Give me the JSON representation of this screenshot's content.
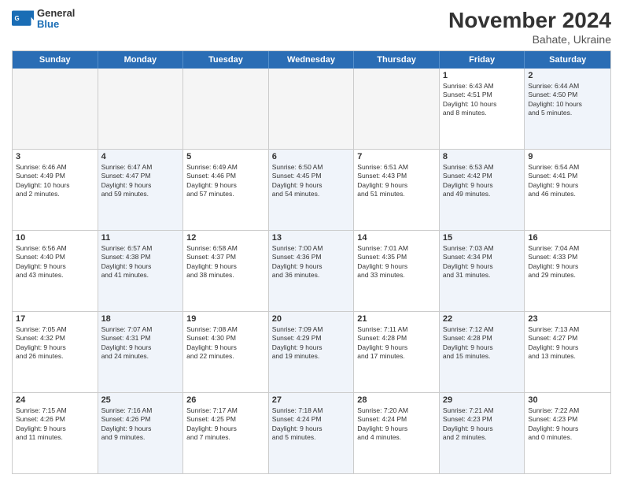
{
  "header": {
    "logo_general": "General",
    "logo_blue": "Blue",
    "month_title": "November 2024",
    "location": "Bahate, Ukraine"
  },
  "days_of_week": [
    "Sunday",
    "Monday",
    "Tuesday",
    "Wednesday",
    "Thursday",
    "Friday",
    "Saturday"
  ],
  "weeks": [
    [
      {
        "day": "",
        "info": "",
        "empty": true
      },
      {
        "day": "",
        "info": "",
        "empty": true
      },
      {
        "day": "",
        "info": "",
        "empty": true
      },
      {
        "day": "",
        "info": "",
        "empty": true
      },
      {
        "day": "",
        "info": "",
        "empty": true
      },
      {
        "day": "1",
        "info": "Sunrise: 6:43 AM\nSunset: 4:51 PM\nDaylight: 10 hours\nand 8 minutes.",
        "empty": false
      },
      {
        "day": "2",
        "info": "Sunrise: 6:44 AM\nSunset: 4:50 PM\nDaylight: 10 hours\nand 5 minutes.",
        "empty": false,
        "alt": true
      }
    ],
    [
      {
        "day": "3",
        "info": "Sunrise: 6:46 AM\nSunset: 4:49 PM\nDaylight: 10 hours\nand 2 minutes.",
        "empty": false
      },
      {
        "day": "4",
        "info": "Sunrise: 6:47 AM\nSunset: 4:47 PM\nDaylight: 9 hours\nand 59 minutes.",
        "empty": false,
        "alt": true
      },
      {
        "day": "5",
        "info": "Sunrise: 6:49 AM\nSunset: 4:46 PM\nDaylight: 9 hours\nand 57 minutes.",
        "empty": false
      },
      {
        "day": "6",
        "info": "Sunrise: 6:50 AM\nSunset: 4:45 PM\nDaylight: 9 hours\nand 54 minutes.",
        "empty": false,
        "alt": true
      },
      {
        "day": "7",
        "info": "Sunrise: 6:51 AM\nSunset: 4:43 PM\nDaylight: 9 hours\nand 51 minutes.",
        "empty": false
      },
      {
        "day": "8",
        "info": "Sunrise: 6:53 AM\nSunset: 4:42 PM\nDaylight: 9 hours\nand 49 minutes.",
        "empty": false,
        "alt": true
      },
      {
        "day": "9",
        "info": "Sunrise: 6:54 AM\nSunset: 4:41 PM\nDaylight: 9 hours\nand 46 minutes.",
        "empty": false
      }
    ],
    [
      {
        "day": "10",
        "info": "Sunrise: 6:56 AM\nSunset: 4:40 PM\nDaylight: 9 hours\nand 43 minutes.",
        "empty": false
      },
      {
        "day": "11",
        "info": "Sunrise: 6:57 AM\nSunset: 4:38 PM\nDaylight: 9 hours\nand 41 minutes.",
        "empty": false,
        "alt": true
      },
      {
        "day": "12",
        "info": "Sunrise: 6:58 AM\nSunset: 4:37 PM\nDaylight: 9 hours\nand 38 minutes.",
        "empty": false
      },
      {
        "day": "13",
        "info": "Sunrise: 7:00 AM\nSunset: 4:36 PM\nDaylight: 9 hours\nand 36 minutes.",
        "empty": false,
        "alt": true
      },
      {
        "day": "14",
        "info": "Sunrise: 7:01 AM\nSunset: 4:35 PM\nDaylight: 9 hours\nand 33 minutes.",
        "empty": false
      },
      {
        "day": "15",
        "info": "Sunrise: 7:03 AM\nSunset: 4:34 PM\nDaylight: 9 hours\nand 31 minutes.",
        "empty": false,
        "alt": true
      },
      {
        "day": "16",
        "info": "Sunrise: 7:04 AM\nSunset: 4:33 PM\nDaylight: 9 hours\nand 29 minutes.",
        "empty": false
      }
    ],
    [
      {
        "day": "17",
        "info": "Sunrise: 7:05 AM\nSunset: 4:32 PM\nDaylight: 9 hours\nand 26 minutes.",
        "empty": false
      },
      {
        "day": "18",
        "info": "Sunrise: 7:07 AM\nSunset: 4:31 PM\nDaylight: 9 hours\nand 24 minutes.",
        "empty": false,
        "alt": true
      },
      {
        "day": "19",
        "info": "Sunrise: 7:08 AM\nSunset: 4:30 PM\nDaylight: 9 hours\nand 22 minutes.",
        "empty": false
      },
      {
        "day": "20",
        "info": "Sunrise: 7:09 AM\nSunset: 4:29 PM\nDaylight: 9 hours\nand 19 minutes.",
        "empty": false,
        "alt": true
      },
      {
        "day": "21",
        "info": "Sunrise: 7:11 AM\nSunset: 4:28 PM\nDaylight: 9 hours\nand 17 minutes.",
        "empty": false
      },
      {
        "day": "22",
        "info": "Sunrise: 7:12 AM\nSunset: 4:28 PM\nDaylight: 9 hours\nand 15 minutes.",
        "empty": false,
        "alt": true
      },
      {
        "day": "23",
        "info": "Sunrise: 7:13 AM\nSunset: 4:27 PM\nDaylight: 9 hours\nand 13 minutes.",
        "empty": false
      }
    ],
    [
      {
        "day": "24",
        "info": "Sunrise: 7:15 AM\nSunset: 4:26 PM\nDaylight: 9 hours\nand 11 minutes.",
        "empty": false
      },
      {
        "day": "25",
        "info": "Sunrise: 7:16 AM\nSunset: 4:26 PM\nDaylight: 9 hours\nand 9 minutes.",
        "empty": false,
        "alt": true
      },
      {
        "day": "26",
        "info": "Sunrise: 7:17 AM\nSunset: 4:25 PM\nDaylight: 9 hours\nand 7 minutes.",
        "empty": false
      },
      {
        "day": "27",
        "info": "Sunrise: 7:18 AM\nSunset: 4:24 PM\nDaylight: 9 hours\nand 5 minutes.",
        "empty": false,
        "alt": true
      },
      {
        "day": "28",
        "info": "Sunrise: 7:20 AM\nSunset: 4:24 PM\nDaylight: 9 hours\nand 4 minutes.",
        "empty": false
      },
      {
        "day": "29",
        "info": "Sunrise: 7:21 AM\nSunset: 4:23 PM\nDaylight: 9 hours\nand 2 minutes.",
        "empty": false,
        "alt": true
      },
      {
        "day": "30",
        "info": "Sunrise: 7:22 AM\nSunset: 4:23 PM\nDaylight: 9 hours\nand 0 minutes.",
        "empty": false
      }
    ]
  ]
}
